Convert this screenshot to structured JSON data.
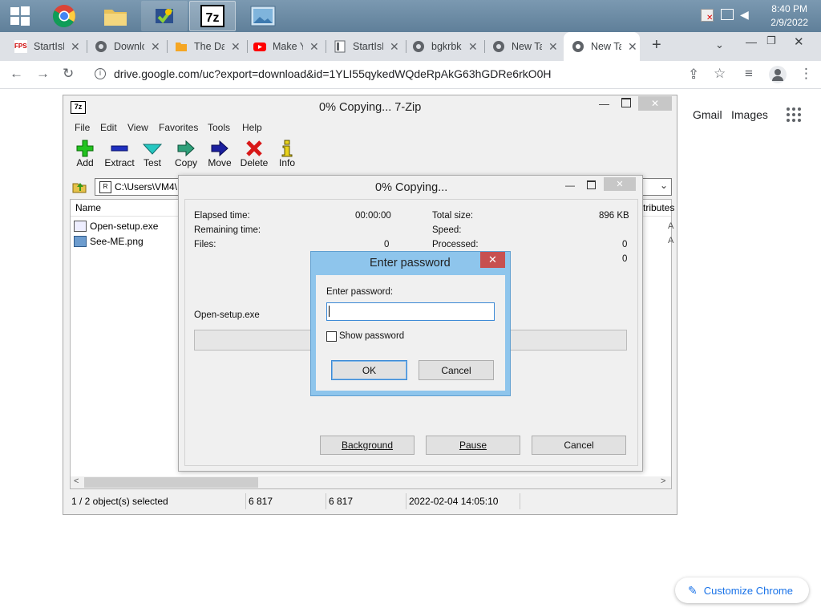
{
  "taskbar": {
    "clock_time": "8:40 PM",
    "clock_date": "2/9/2022"
  },
  "chrome": {
    "tabs": [
      {
        "label": "StartIsBack"
      },
      {
        "label": "Download"
      },
      {
        "label": "The Daily"
      },
      {
        "label": "Make Your"
      },
      {
        "label": "StartIsBack"
      },
      {
        "label": "bgkrbk"
      },
      {
        "label": "New Tab"
      },
      {
        "label": "New Tab"
      }
    ],
    "url": "drive.google.com/uc?export=download&id=1YLI55qykedWQdeRpAkG63hGDRe6rkO0H"
  },
  "google": {
    "gmail": "Gmail",
    "images": "Images",
    "customize": "Customize Chrome"
  },
  "zip": {
    "title": "0% Copying... 7-Zip",
    "menu": [
      "File",
      "Edit",
      "View",
      "Favorites",
      "Tools",
      "Help"
    ],
    "toolbar": [
      "Add",
      "Extract",
      "Test",
      "Copy",
      "Move",
      "Delete",
      "Info"
    ],
    "path": "C:\\Users\\VM4\\",
    "col_name": "Name",
    "col_attributes": "tributes",
    "files": [
      {
        "name": "Open-setup.exe"
      },
      {
        "name": "See-ME.png"
      }
    ],
    "status": {
      "selected": "1 / 2 object(s) selected",
      "size": "6 817",
      "packed": "6 817",
      "modified": "2022-02-04 14:05:10"
    }
  },
  "copy": {
    "title": "0% Copying...",
    "elapsed_label": "Elapsed time:",
    "elapsed_value": "00:00:00",
    "remaining_label": "Remaining time:",
    "files_label": "Files:",
    "files_value": "0",
    "total_label": "Total size:",
    "total_value": "896 KB",
    "speed_label": "Speed:",
    "processed_label": "Processed:",
    "processed_value": "0",
    "extra_value": "0",
    "current_file": "Open-setup.exe",
    "progress": 0,
    "btn_background": "Background",
    "btn_pause": "Pause",
    "btn_cancel": "Cancel"
  },
  "password": {
    "title": "Enter password",
    "prompt": "Enter password:",
    "value": "",
    "show_label": "Show password",
    "show_checked": false,
    "ok": "OK",
    "cancel": "Cancel"
  }
}
